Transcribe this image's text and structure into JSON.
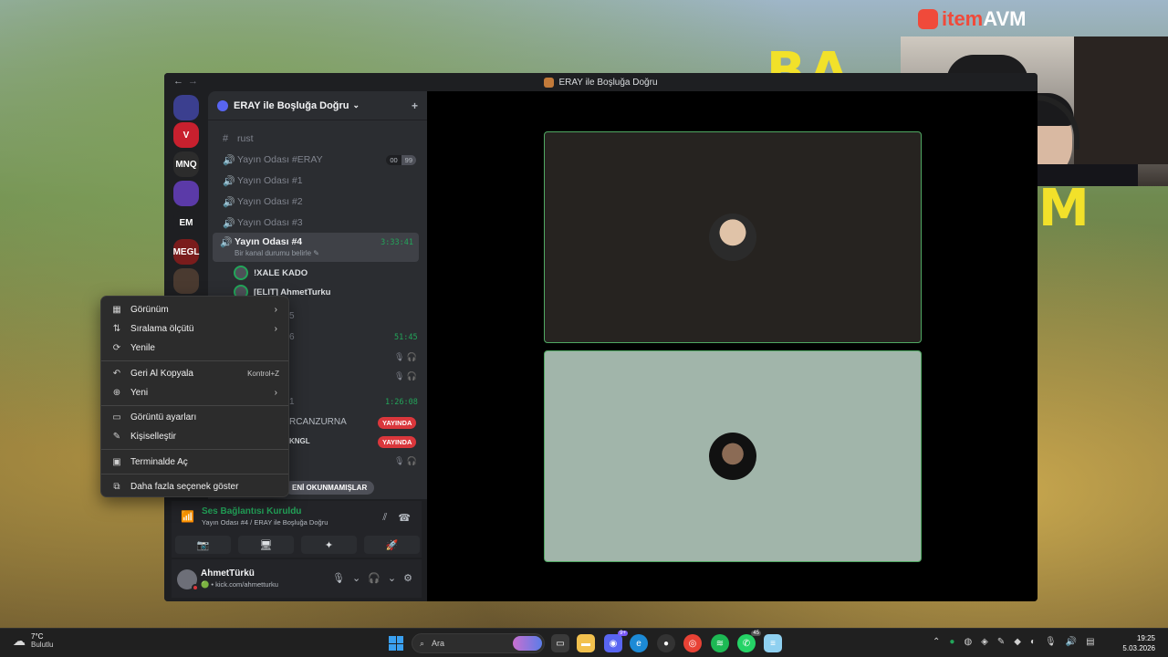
{
  "wallpaper": {
    "text_top": "BA",
    "text_right": "M"
  },
  "brand": {
    "prefix": "item",
    "suffix": "AVM"
  },
  "window": {
    "title": "ERAY ile Boşluğa Doğru",
    "back": "←",
    "forward": "→"
  },
  "guilds": [
    {
      "label": "",
      "color": "#3b3f8f"
    },
    {
      "label": "V",
      "color": "#c8202e"
    },
    {
      "label": "MNQ",
      "color": "#2c2c2c"
    },
    {
      "label": "",
      "color": "#5b3aa8"
    },
    {
      "label": "EM",
      "color": "#1e1f22"
    },
    {
      "label": "MEGL",
      "color": "#7a1c1c"
    },
    {
      "label": "",
      "color": "#4a3a30"
    }
  ],
  "server": {
    "name": "ERAY ile Boşluğa Doğru",
    "chevron": "⌄",
    "invite_icon": "+"
  },
  "channels": [
    {
      "icon": "#",
      "name": "rust"
    },
    {
      "icon": "🔊",
      "name": "Yayın Odası #ERAY",
      "pill_a": "00",
      "pill_b": "99"
    },
    {
      "icon": "🔊",
      "name": "Yayın Odası #1"
    },
    {
      "icon": "🔊",
      "name": "Yayın Odası #2"
    },
    {
      "icon": "🔊",
      "name": "Yayın Odası #3"
    },
    {
      "icon": "🔊",
      "name": "Yayın Odası #4",
      "timer": "3:33:41",
      "status": "Bir kanal durumu belirle ✎"
    }
  ],
  "members": [
    {
      "name": "!XALE KADO"
    },
    {
      "name": "[ELIT] AhmetTurku"
    }
  ],
  "fragments": {
    "f1": "5",
    "f2": "6",
    "f3": "1",
    "f4": "RCANZURNA",
    "f5": "KNGL",
    "timer_a": "51:45",
    "timer_b": "1:26:08",
    "live_1": "YAYINDA",
    "live_2": "YAYINDA",
    "mute": "🎙 🎧"
  },
  "unread": "ENİ OKUNMAMIŞLAR",
  "voice": {
    "title": "Ses Bağlantısı Kuruldu",
    "subtitle": "Yayın Odası #4 / ERAY ile Boşluğa Doğru",
    "buttons": [
      "📷",
      "🖥",
      "✦",
      "🚀"
    ]
  },
  "user": {
    "name": "AhmetTürkü",
    "status": "🟢 • kick.com/ahmetturku"
  },
  "context_menu": [
    {
      "icon": "▦",
      "label": "Görünüm",
      "arrow": "›"
    },
    {
      "icon": "⇅",
      "label": "Sıralama ölçütü",
      "arrow": "›"
    },
    {
      "icon": "⟳",
      "label": "Yenile"
    },
    {
      "icon": "↶",
      "label": "Geri Al Kopyala",
      "shortcut": "Kontrol+Z"
    },
    {
      "icon": "⊕",
      "label": "Yeni",
      "arrow": "›"
    },
    {
      "icon": "▭",
      "label": "Görüntü ayarları"
    },
    {
      "icon": "✎",
      "label": "Kişiselleştir"
    },
    {
      "icon": "▣",
      "label": "Terminalde Aç"
    },
    {
      "icon": "⧉",
      "label": "Daha fazla seçenek göster"
    }
  ],
  "taskbar": {
    "temp": "7°C",
    "weather": "Bulutlu",
    "search": "Ara",
    "discord_badge": "9+",
    "whatsapp_badge": "45",
    "time": "19:25",
    "date": "5.03.2026"
  }
}
